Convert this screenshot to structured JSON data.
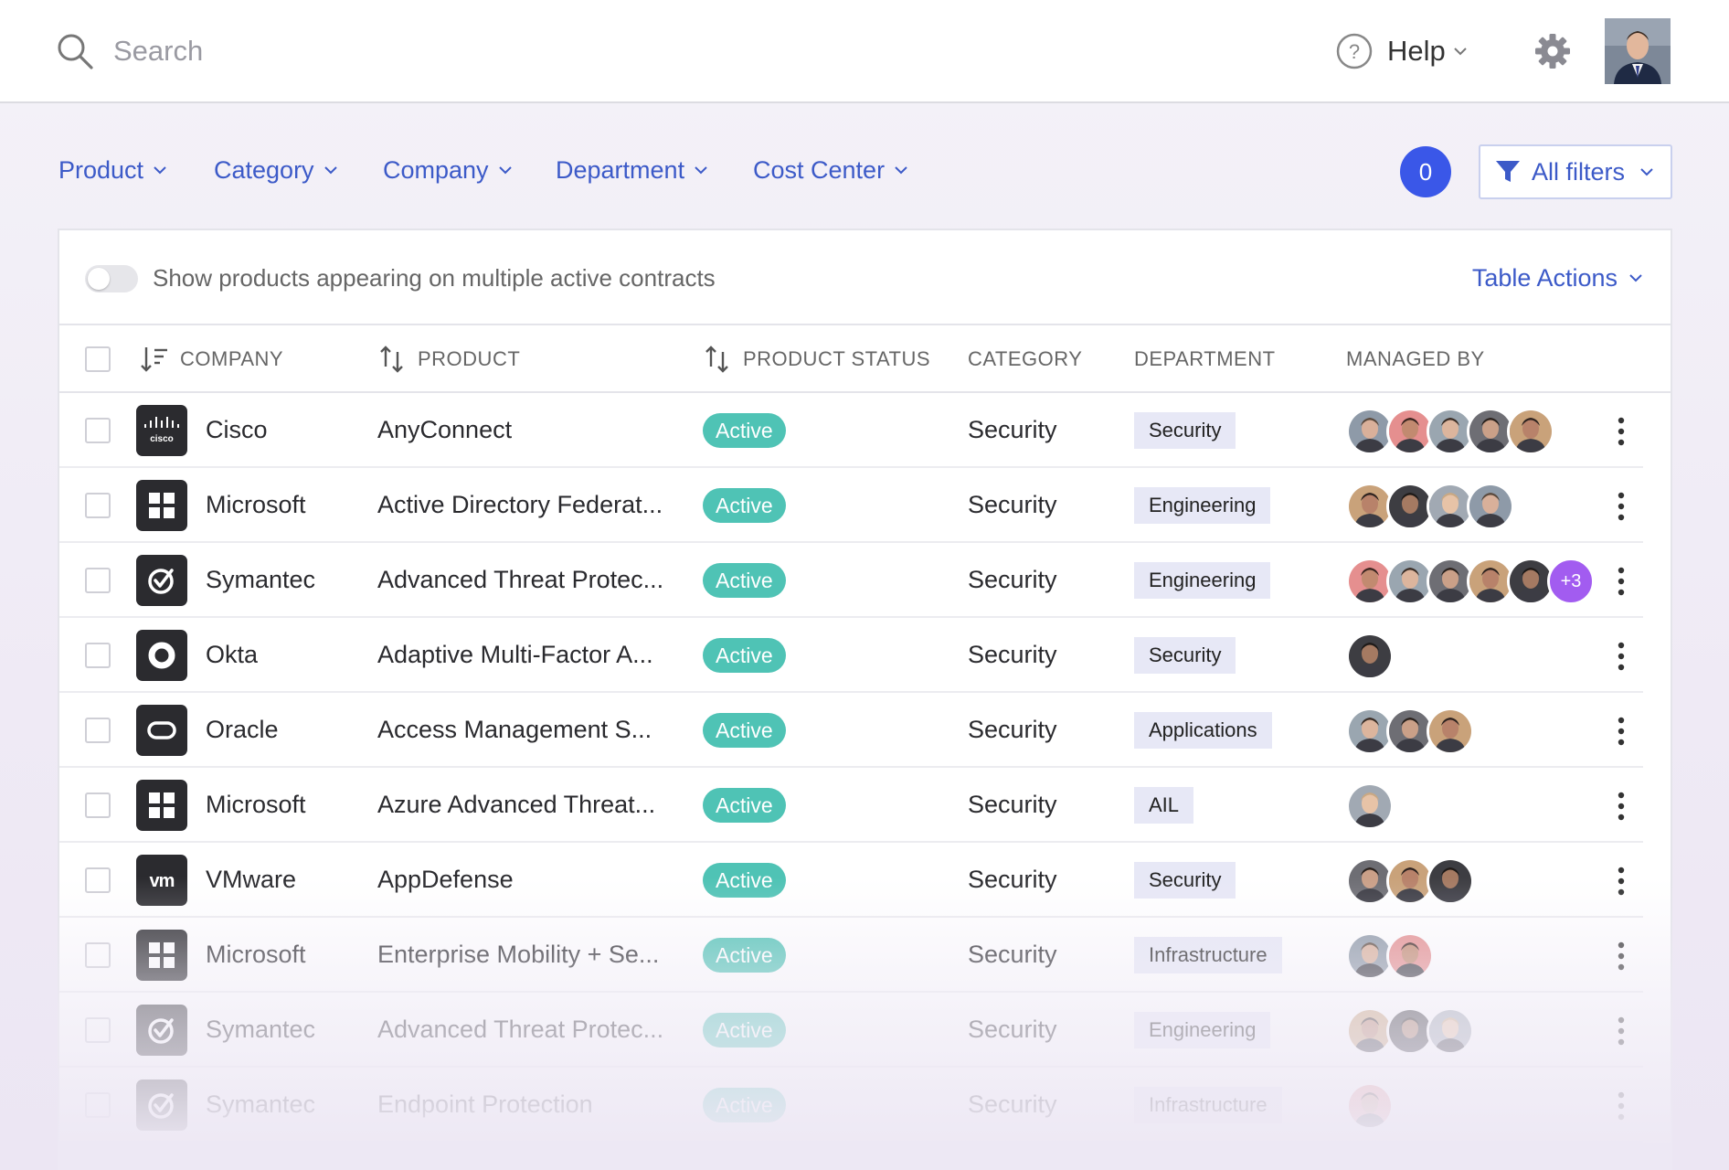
{
  "topbar": {
    "search_placeholder": "Search",
    "help_label": "Help"
  },
  "filters": {
    "items": [
      {
        "label": "Product"
      },
      {
        "label": "Category"
      },
      {
        "label": "Company"
      },
      {
        "label": "Department"
      },
      {
        "label": "Cost Center"
      }
    ],
    "count": "0",
    "all_filters_label": "All filters"
  },
  "card": {
    "toggle_label": "Show products appearing on multiple active contracts",
    "table_actions_label": "Table Actions"
  },
  "table": {
    "headers": {
      "company": "COMPANY",
      "product": "PRODUCT",
      "product_status": "PRODUCT STATUS",
      "category": "CATEGORY",
      "department": "DEPARTMENT",
      "managed_by": "MANAGED BY"
    },
    "rows": [
      {
        "company": "Cisco",
        "logo": "cisco-logo",
        "product": "AnyConnect",
        "status": "Active",
        "category": "Security",
        "department": "Security",
        "avatars": 5,
        "more": ""
      },
      {
        "company": "Microsoft",
        "logo": "windows-logo",
        "product": "Active Directory Federat...",
        "status": "Active",
        "category": "Security",
        "department": "Engineering",
        "avatars": 4,
        "more": ""
      },
      {
        "company": "Symantec",
        "logo": "symantec-logo",
        "product": "Advanced Threat Protec...",
        "status": "Active",
        "category": "Security",
        "department": "Engineering",
        "avatars": 5,
        "more": "+3"
      },
      {
        "company": "Okta",
        "logo": "okta-logo",
        "product": "Adaptive Multi-Factor A...",
        "status": "Active",
        "category": "Security",
        "department": "Security",
        "avatars": 1,
        "more": ""
      },
      {
        "company": "Oracle",
        "logo": "oracle-logo",
        "product": "Access Management S...",
        "status": "Active",
        "category": "Security",
        "department": "Applications",
        "avatars": 3,
        "more": ""
      },
      {
        "company": "Microsoft",
        "logo": "windows-logo",
        "product": "Azure Advanced Threat...",
        "status": "Active",
        "category": "Security",
        "department": "AIL",
        "avatars": 1,
        "more": ""
      },
      {
        "company": "VMware",
        "logo": "vmware-logo",
        "product": "AppDefense",
        "status": "Active",
        "category": "Security",
        "department": "Security",
        "avatars": 3,
        "more": ""
      },
      {
        "company": "Microsoft",
        "logo": "windows-logo",
        "product": "Enterprise Mobility + Se...",
        "status": "Active",
        "category": "Security",
        "department": "Infrastructure",
        "avatars": 2,
        "more": ""
      },
      {
        "company": "Symantec",
        "logo": "symantec-logo",
        "product": "Advanced Threat Protec...",
        "status": "Active",
        "category": "Security",
        "department": "Engineering",
        "avatars": 3,
        "more": ""
      },
      {
        "company": "Symantec",
        "logo": "symantec-logo",
        "product": "Endpoint Protection",
        "status": "Active",
        "category": "Security",
        "department": "Infrastructure",
        "avatars": 1,
        "more": ""
      }
    ]
  },
  "colors": {
    "accent": "#3c5ac8",
    "badge": "#3a57e8",
    "status_active": "#4fc3b5",
    "dept_tag": "#e7e8f6",
    "more_avatar": "#a25cf0"
  }
}
